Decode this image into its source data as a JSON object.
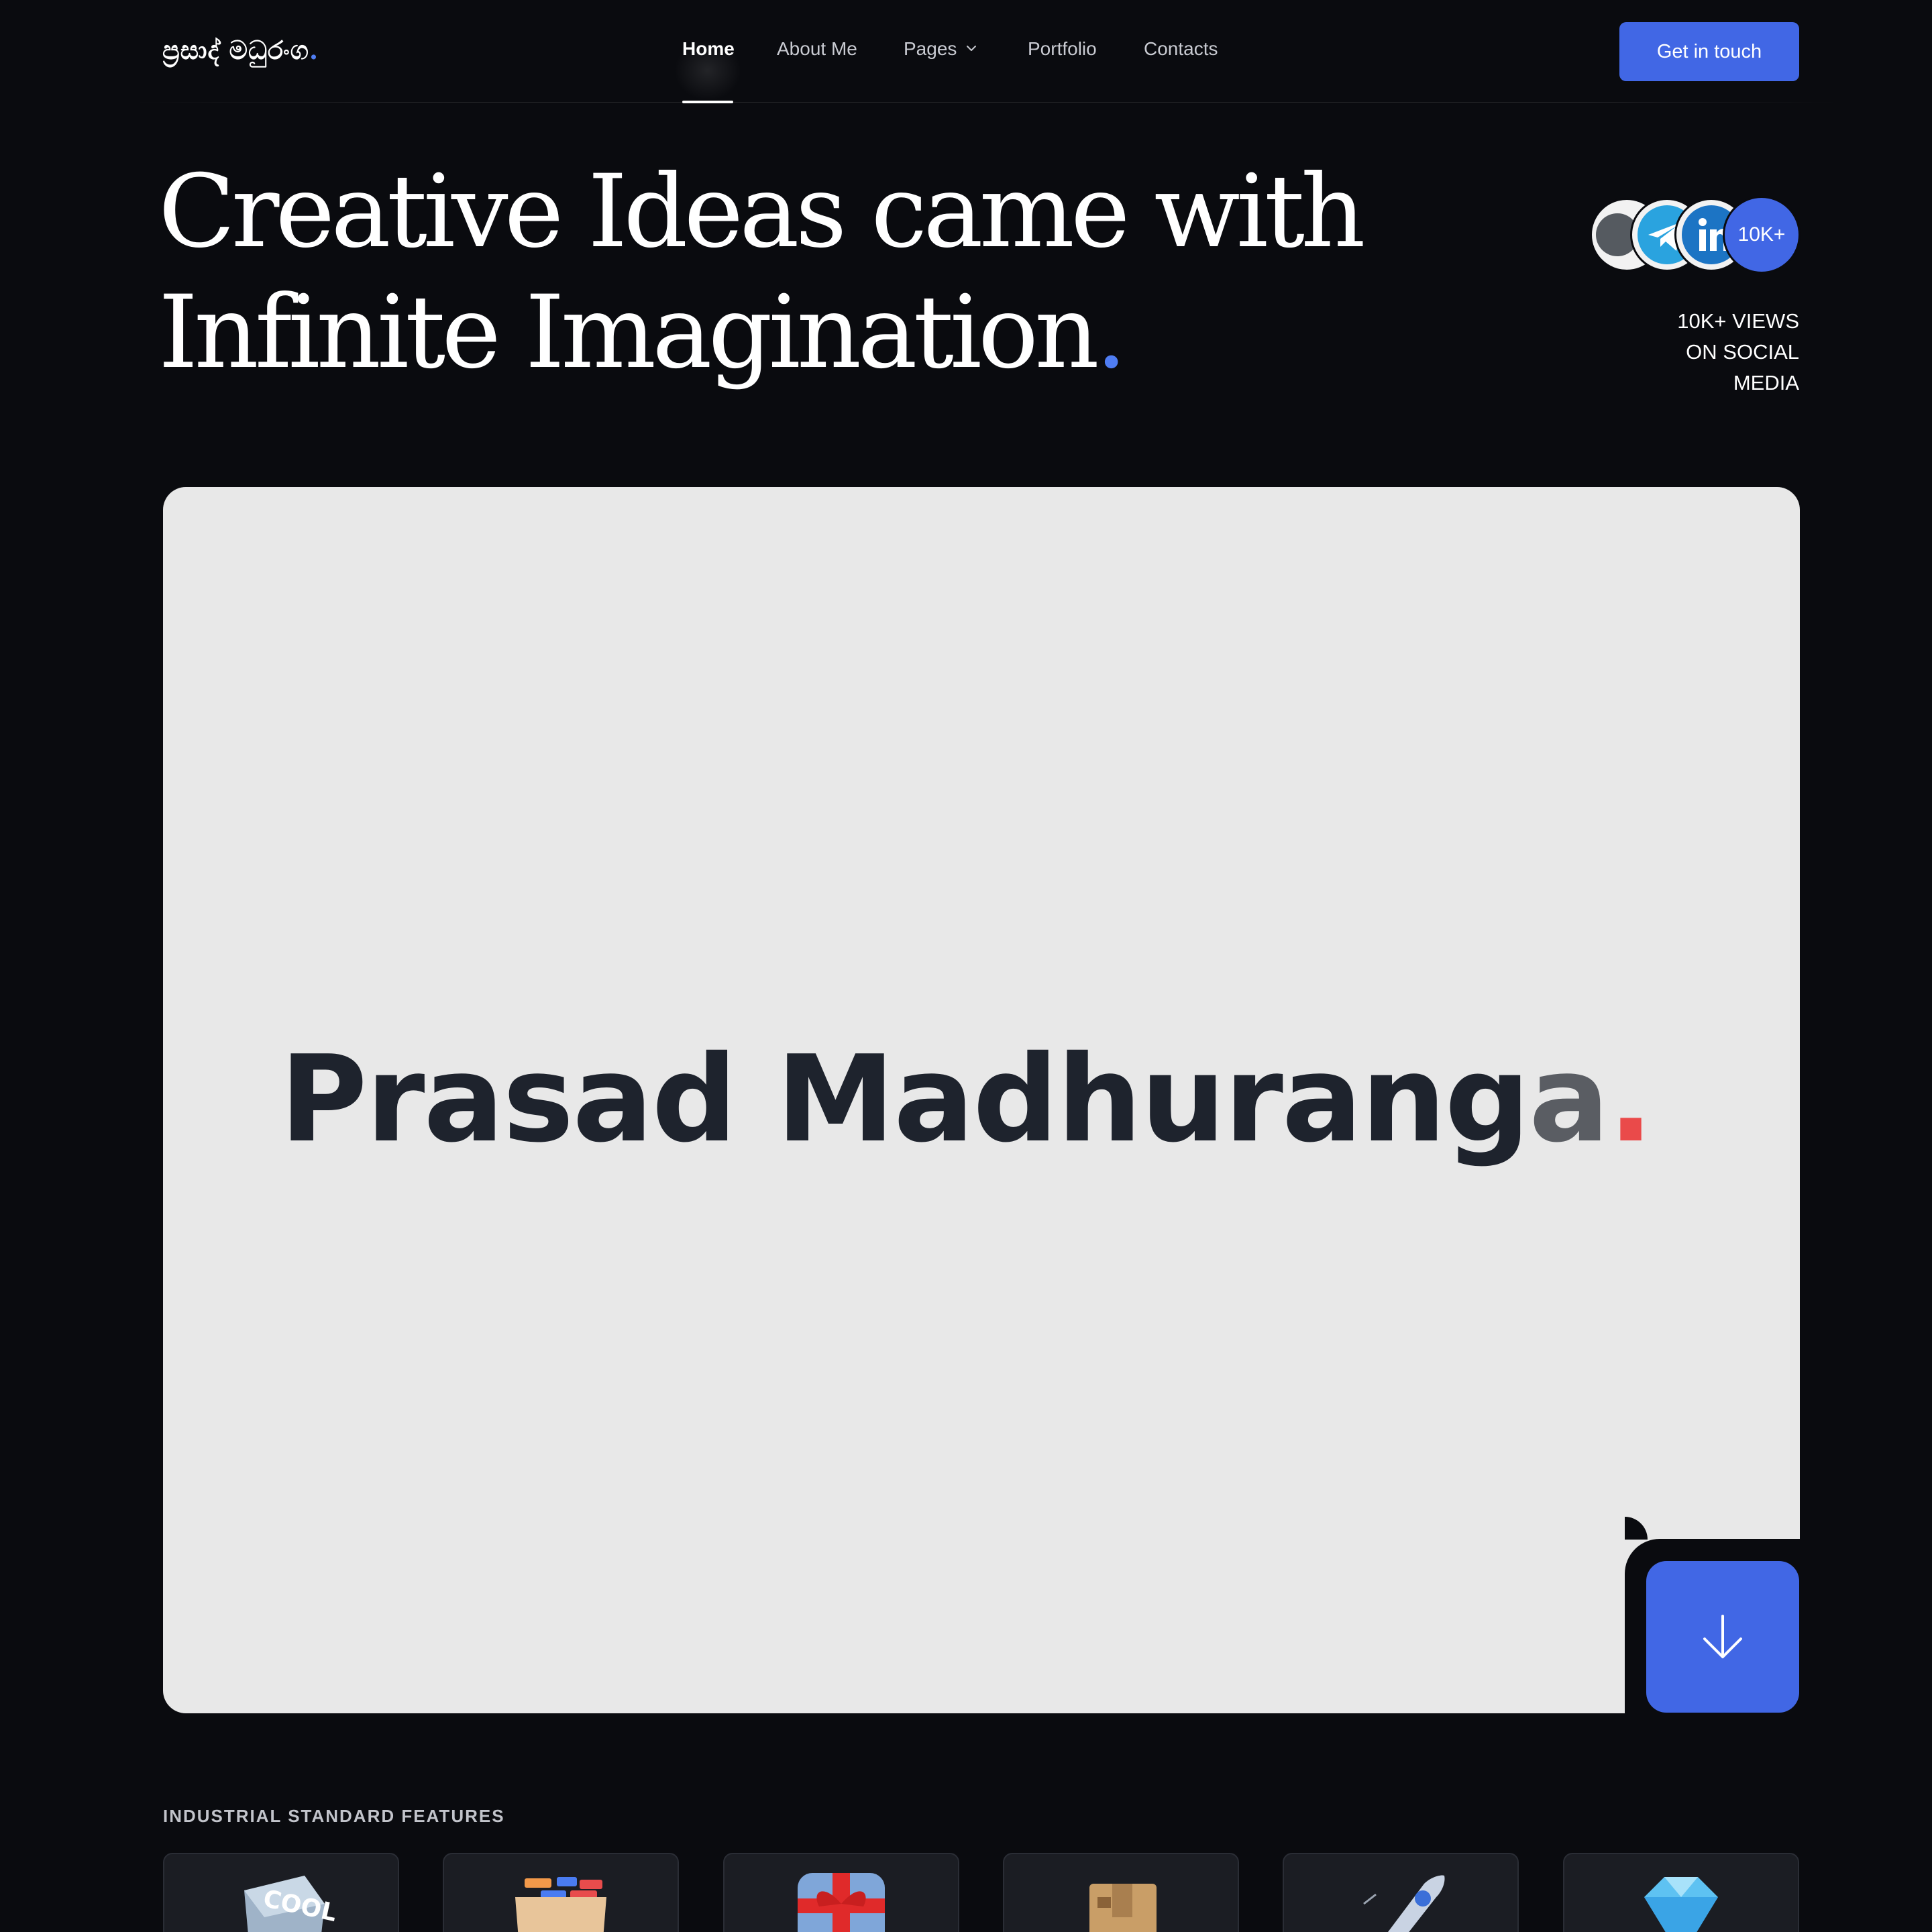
{
  "header": {
    "logo_text": "ප්‍රසාද් මධුරංග",
    "logo_dot": ".",
    "nav": [
      {
        "label": "Home",
        "active": true
      },
      {
        "label": "About Me"
      },
      {
        "label": "Pages",
        "has_dropdown": true
      },
      {
        "label": "Portfolio"
      },
      {
        "label": "Contacts"
      }
    ],
    "cta_label": "Get in touch"
  },
  "hero": {
    "title_line1": "Creative Ideas came with",
    "title_line2": "Infinite Imagination",
    "title_dot": ".",
    "social_badge": "10K+",
    "social_icons": [
      "dot-icon",
      "telegram-icon",
      "linkedin-icon"
    ],
    "views_line1": "10K+ VIEWS",
    "views_line2": "ON SOCIAL",
    "views_line3": "MEDIA"
  },
  "card": {
    "name_main": "Prasad Madhurang",
    "name_fade": "a",
    "name_dot": "."
  },
  "features": {
    "label": "INDUSTRIAL STANDARD FEATURES",
    "items": [
      {
        "icon": "cool-cube-icon",
        "icon_text": "COOL"
      },
      {
        "icon": "file-drawer-icon"
      },
      {
        "icon": "gift-icon"
      },
      {
        "icon": "package-box-icon"
      },
      {
        "icon": "rocket-icon"
      },
      {
        "icon": "diamond-icon"
      }
    ]
  },
  "colors": {
    "background": "#0a0b0f",
    "accent_blue": "#4167e5",
    "card_bg": "#e8e8e8",
    "name_red_dot": "#ea4a4a"
  }
}
